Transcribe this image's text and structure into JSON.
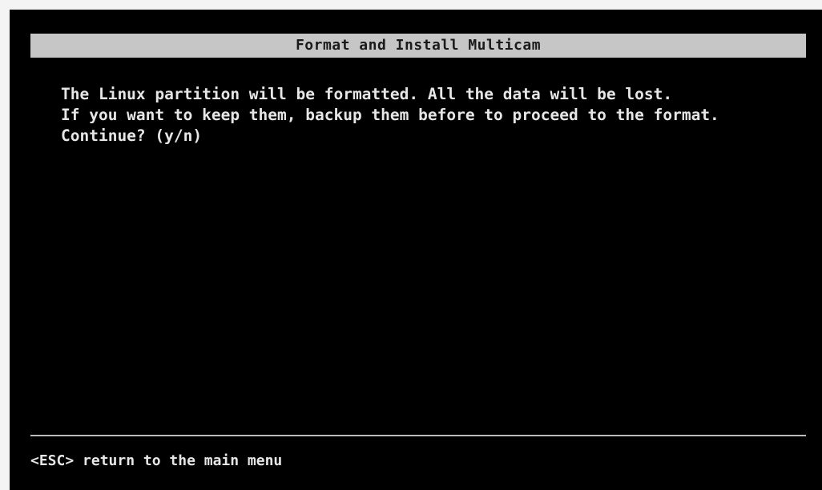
{
  "screen": {
    "title": "Format and Install Multicam",
    "message_lines": [
      "The Linux partition will be formatted. All the data will be lost.",
      "If you want to keep them, backup them before to proceed to the format.",
      "Continue? (y/n)"
    ],
    "footer": "<ESC> return to the main menu"
  },
  "colors": {
    "background": "#000000",
    "title_bar": "#c6c6c6",
    "text": "#e6e6e6"
  }
}
